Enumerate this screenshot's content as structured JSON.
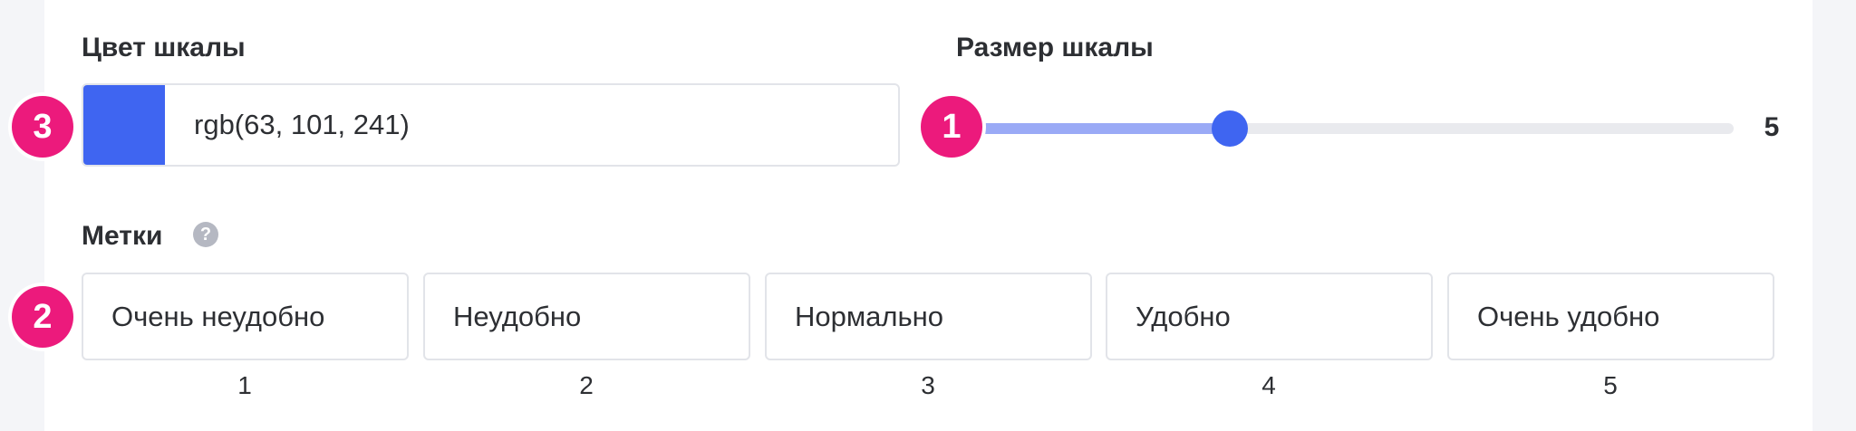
{
  "color_section": {
    "title": "Цвет шкалы",
    "value": "rgb(63, 101, 241)",
    "swatch_color": "#3f65f1"
  },
  "size_section": {
    "title": "Размер шкалы",
    "value": "5",
    "slider_level_fraction": 0.35,
    "accent_color": "#3f65f1"
  },
  "labels_section": {
    "title": "Метки",
    "help_icon": "?",
    "items": [
      {
        "label": "Очень неудобно",
        "index": "1"
      },
      {
        "label": "Неудобно",
        "index": "2"
      },
      {
        "label": "Нормально",
        "index": "3"
      },
      {
        "label": "Удобно",
        "index": "4"
      },
      {
        "label": "Очень удобно",
        "index": "5"
      }
    ]
  },
  "annotations": {
    "badge_slider": "1",
    "badge_labels": "2",
    "badge_color": "3",
    "badge_color_hex": "#ec1a7c"
  }
}
